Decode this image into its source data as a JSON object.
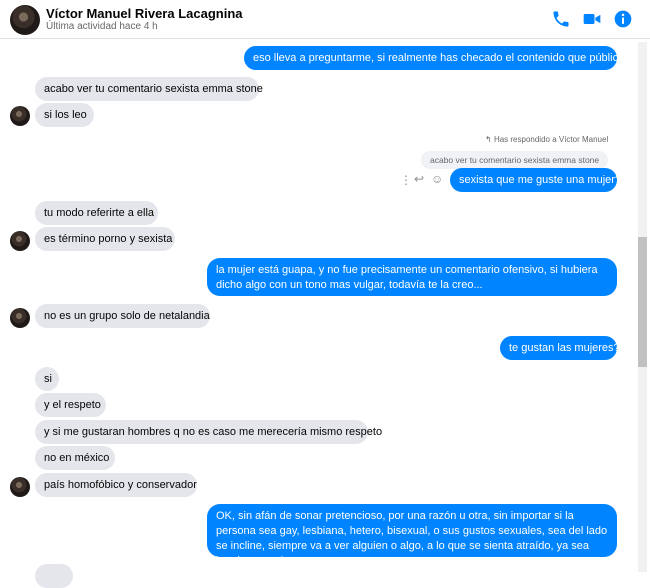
{
  "contact": {
    "name": "Víctor Manuel Rivera Lacagnina",
    "status": "Última actividad hace 4 h"
  },
  "header_icons": [
    "phone-icon",
    "video-camera-icon",
    "info-icon"
  ],
  "colors": {
    "accent": "#0084ff",
    "incoming_bubble": "#e4e6eb"
  },
  "messages": {
    "m1": "eso lleva a preguntarme, si realmente has checado el contenido que público...",
    "m2": "acabo ver tu comentario sexista emma stone",
    "m3": "si los leo",
    "reply_note": "Has respondido a Víctor Manuel",
    "quoted": "acabo ver tu comentario sexista emma stone",
    "m4": "sexista que me guste una mujer?",
    "m5": "tu modo referirte a ella",
    "m6": "es término porno y sexista",
    "m7": "la mujer está guapa, y no fue precisamente un comentario ofensivo, si hubiera dicho algo con un tono mas vulgar, todavía te la creo...",
    "m8": "no es un grupo solo de netalandia",
    "m9": "te gustan las mujeres?",
    "m10": "si",
    "m11": "y el respeto",
    "m12": "y si me gustaran hombres q no es caso me merecería mismo respeto",
    "m13": "no en méxico",
    "m14": "país homofóbico y conservador",
    "m15": "OK, sin afán de sonar pretencioso, por una razón u otra, sin importar si la persona sea gay, lesbiana, hetero, bisexual, o sus gustos sexuales, sea del lado se incline, siempre va a ver alguien o algo, a lo que se sienta atraído, ya sea hombre o mujer..."
  }
}
